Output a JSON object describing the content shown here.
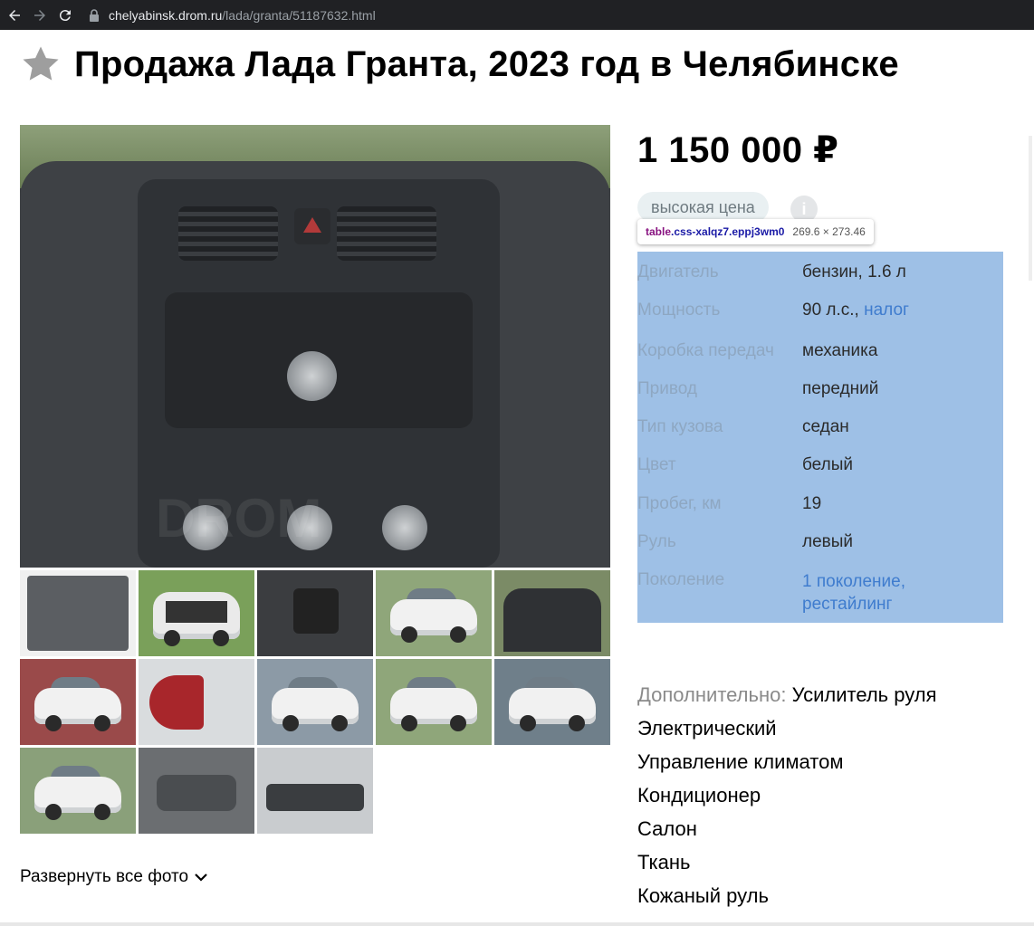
{
  "browser": {
    "url_host": "chelyabinsk.drom.ru",
    "url_path": "/lada/granta/51187632.html"
  },
  "header": {
    "title": "Продажа Лада Гранта, 2023 год в Челябинске"
  },
  "gallery": {
    "watermark": "DROM",
    "thumb_count": 13,
    "expand_label": "Развернуть все фото"
  },
  "listing": {
    "price": "1 150 000 ₽",
    "price_badge": "высокая цена",
    "info_icon": "i"
  },
  "inspector": {
    "tag": "table",
    "class_name": ".css-xalqz7.eppj3wm0",
    "dimensions": "269.6 × 273.46"
  },
  "specs": {
    "rows": [
      {
        "label": "Двигатель",
        "value": "бензин, 1.6 л"
      },
      {
        "label": "Мощность",
        "value": "90 л.с.,",
        "link": "налог"
      },
      {
        "label": "Коробка передач",
        "value": "механика"
      },
      {
        "label": "Привод",
        "value": "передний"
      },
      {
        "label": "Тип кузова",
        "value": "седан"
      },
      {
        "label": "Цвет",
        "value": "белый"
      },
      {
        "label": "Пробег, км",
        "value": "19"
      },
      {
        "label": "Руль",
        "value": "левый"
      },
      {
        "label": "Поколение",
        "link_line1": "1 поколение,",
        "link_line2": "рестайлинг"
      }
    ]
  },
  "extras": {
    "label": "Дополнительно:",
    "first": "Усилитель руля",
    "lines": [
      "Электрический",
      "Управление климатом",
      "Кондиционер",
      "Салон",
      "Ткань",
      "Кожаный руль"
    ]
  },
  "colors": {
    "accent_link": "#3f7cce",
    "inspector_highlight": "#9ec0e6"
  }
}
